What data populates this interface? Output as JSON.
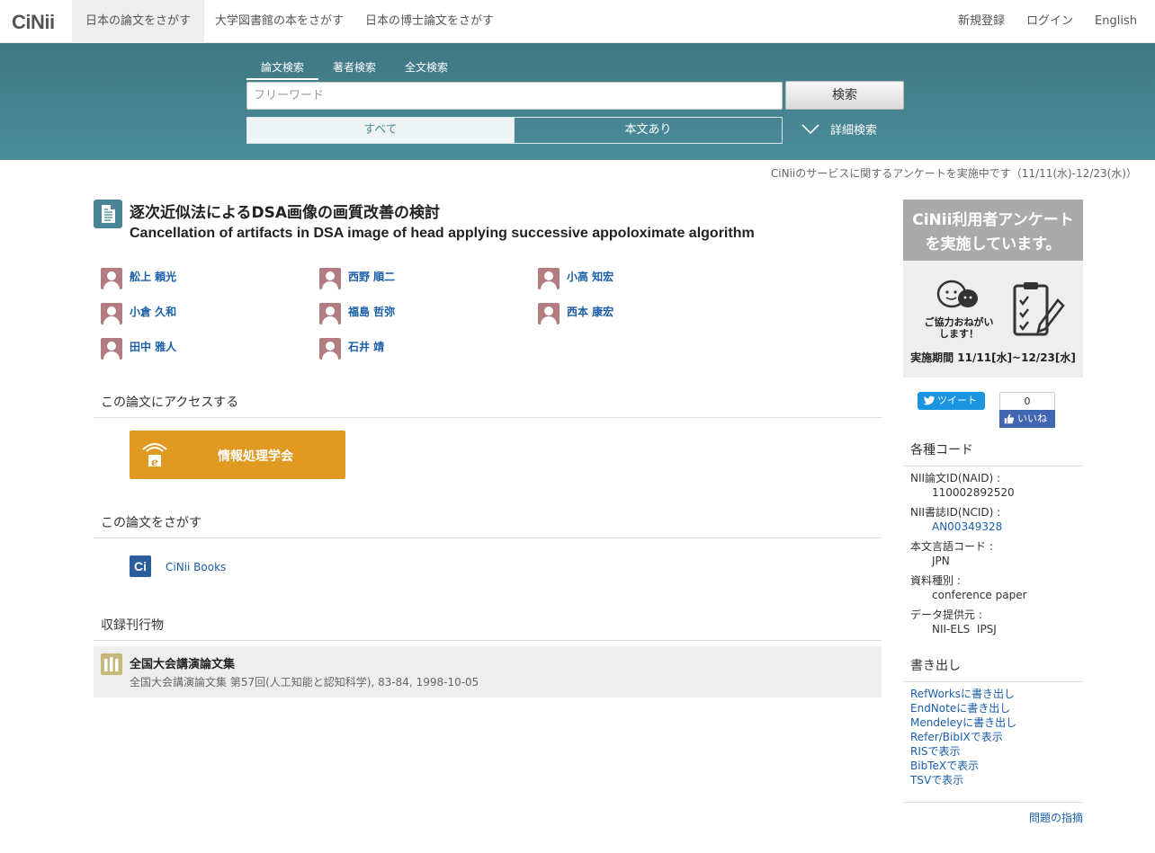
{
  "header": {
    "logo": "CiNii",
    "nav": [
      "日本の論文をさがす",
      "大学図書館の本をさがす",
      "日本の博士論文をさがす"
    ],
    "right": [
      "新規登録",
      "ログイン",
      "English"
    ]
  },
  "search": {
    "tabs": [
      "論文検索",
      "著者検索",
      "全文検索"
    ],
    "placeholder": "フリーワード",
    "button": "検索",
    "filters": [
      "すべて",
      "本文あり"
    ],
    "advanced": "詳細検索"
  },
  "notice": "CiNiiのサービスに関するアンケートを実施中です（11/11(水)-12/23(水)）",
  "article": {
    "title_ja": "逐次近似法によるDSA画像の画質改善の検討",
    "title_en": "Cancellation of artifacts in DSA image of head applying successive appoloximate algorithm",
    "authors": [
      "舩上 頼光",
      "西野 順二",
      "小高 知宏",
      "小倉 久和",
      "福島 哲弥",
      "西本 康宏",
      "田中 雅人",
      "石井 靖"
    ]
  },
  "access": {
    "heading": "この論文にアクセスする",
    "provider": "情報処理学会"
  },
  "find": {
    "heading": "この論文をさがす",
    "link": "CiNii Books"
  },
  "journal": {
    "heading": "収録刊行物",
    "name": "全国大会講演論文集",
    "meta": "全国大会講演論文集 第57回(人工知能と認知科学), 83-84, 1998-10-05"
  },
  "survey_banner": {
    "line1": "CiNii利用者アンケート",
    "line2": "を実施しています。",
    "bubble": "ご協力おねがいします！",
    "period": "実施期間 11/11[水]~12/23[水]"
  },
  "social": {
    "tweet": "ツイート",
    "like_count": "0",
    "like": "いいね"
  },
  "codes": {
    "heading": "各種コード",
    "items": [
      {
        "label": "NII論文ID(NAID) :",
        "value": "110002892520"
      },
      {
        "label": "NII書誌ID(NCID) :",
        "value": "AN00349328"
      },
      {
        "label": "本文言語コード :",
        "value": "JPN"
      },
      {
        "label": "資料種別 :",
        "value": "conference paper"
      },
      {
        "label": "データ提供元 :",
        "value": "NII-ELS  IPSJ"
      }
    ]
  },
  "export": {
    "heading": "書き出し",
    "items": [
      "RefWorksに書き出し",
      "EndNoteに書き出し",
      "Mendeleyに書き出し",
      "Refer/BibIXで表示",
      "RISで表示",
      "BibTeXで表示",
      "TSVで表示"
    ]
  },
  "report": "問題の指摘"
}
